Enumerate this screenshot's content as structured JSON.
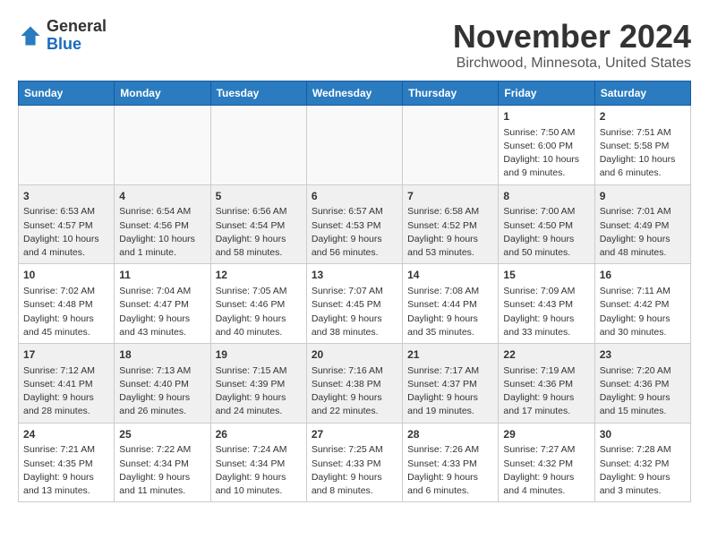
{
  "header": {
    "logo_general": "General",
    "logo_blue": "Blue",
    "month": "November 2024",
    "location": "Birchwood, Minnesota, United States"
  },
  "days_of_week": [
    "Sunday",
    "Monday",
    "Tuesday",
    "Wednesday",
    "Thursday",
    "Friday",
    "Saturday"
  ],
  "weeks": [
    [
      {
        "day": "",
        "text": ""
      },
      {
        "day": "",
        "text": ""
      },
      {
        "day": "",
        "text": ""
      },
      {
        "day": "",
        "text": ""
      },
      {
        "day": "",
        "text": ""
      },
      {
        "day": "1",
        "text": "Sunrise: 7:50 AM\nSunset: 6:00 PM\nDaylight: 10 hours and 9 minutes."
      },
      {
        "day": "2",
        "text": "Sunrise: 7:51 AM\nSunset: 5:58 PM\nDaylight: 10 hours and 6 minutes."
      }
    ],
    [
      {
        "day": "3",
        "text": "Sunrise: 6:53 AM\nSunset: 4:57 PM\nDaylight: 10 hours and 4 minutes."
      },
      {
        "day": "4",
        "text": "Sunrise: 6:54 AM\nSunset: 4:56 PM\nDaylight: 10 hours and 1 minute."
      },
      {
        "day": "5",
        "text": "Sunrise: 6:56 AM\nSunset: 4:54 PM\nDaylight: 9 hours and 58 minutes."
      },
      {
        "day": "6",
        "text": "Sunrise: 6:57 AM\nSunset: 4:53 PM\nDaylight: 9 hours and 56 minutes."
      },
      {
        "day": "7",
        "text": "Sunrise: 6:58 AM\nSunset: 4:52 PM\nDaylight: 9 hours and 53 minutes."
      },
      {
        "day": "8",
        "text": "Sunrise: 7:00 AM\nSunset: 4:50 PM\nDaylight: 9 hours and 50 minutes."
      },
      {
        "day": "9",
        "text": "Sunrise: 7:01 AM\nSunset: 4:49 PM\nDaylight: 9 hours and 48 minutes."
      }
    ],
    [
      {
        "day": "10",
        "text": "Sunrise: 7:02 AM\nSunset: 4:48 PM\nDaylight: 9 hours and 45 minutes."
      },
      {
        "day": "11",
        "text": "Sunrise: 7:04 AM\nSunset: 4:47 PM\nDaylight: 9 hours and 43 minutes."
      },
      {
        "day": "12",
        "text": "Sunrise: 7:05 AM\nSunset: 4:46 PM\nDaylight: 9 hours and 40 minutes."
      },
      {
        "day": "13",
        "text": "Sunrise: 7:07 AM\nSunset: 4:45 PM\nDaylight: 9 hours and 38 minutes."
      },
      {
        "day": "14",
        "text": "Sunrise: 7:08 AM\nSunset: 4:44 PM\nDaylight: 9 hours and 35 minutes."
      },
      {
        "day": "15",
        "text": "Sunrise: 7:09 AM\nSunset: 4:43 PM\nDaylight: 9 hours and 33 minutes."
      },
      {
        "day": "16",
        "text": "Sunrise: 7:11 AM\nSunset: 4:42 PM\nDaylight: 9 hours and 30 minutes."
      }
    ],
    [
      {
        "day": "17",
        "text": "Sunrise: 7:12 AM\nSunset: 4:41 PM\nDaylight: 9 hours and 28 minutes."
      },
      {
        "day": "18",
        "text": "Sunrise: 7:13 AM\nSunset: 4:40 PM\nDaylight: 9 hours and 26 minutes."
      },
      {
        "day": "19",
        "text": "Sunrise: 7:15 AM\nSunset: 4:39 PM\nDaylight: 9 hours and 24 minutes."
      },
      {
        "day": "20",
        "text": "Sunrise: 7:16 AM\nSunset: 4:38 PM\nDaylight: 9 hours and 22 minutes."
      },
      {
        "day": "21",
        "text": "Sunrise: 7:17 AM\nSunset: 4:37 PM\nDaylight: 9 hours and 19 minutes."
      },
      {
        "day": "22",
        "text": "Sunrise: 7:19 AM\nSunset: 4:36 PM\nDaylight: 9 hours and 17 minutes."
      },
      {
        "day": "23",
        "text": "Sunrise: 7:20 AM\nSunset: 4:36 PM\nDaylight: 9 hours and 15 minutes."
      }
    ],
    [
      {
        "day": "24",
        "text": "Sunrise: 7:21 AM\nSunset: 4:35 PM\nDaylight: 9 hours and 13 minutes."
      },
      {
        "day": "25",
        "text": "Sunrise: 7:22 AM\nSunset: 4:34 PM\nDaylight: 9 hours and 11 minutes."
      },
      {
        "day": "26",
        "text": "Sunrise: 7:24 AM\nSunset: 4:34 PM\nDaylight: 9 hours and 10 minutes."
      },
      {
        "day": "27",
        "text": "Sunrise: 7:25 AM\nSunset: 4:33 PM\nDaylight: 9 hours and 8 minutes."
      },
      {
        "day": "28",
        "text": "Sunrise: 7:26 AM\nSunset: 4:33 PM\nDaylight: 9 hours and 6 minutes."
      },
      {
        "day": "29",
        "text": "Sunrise: 7:27 AM\nSunset: 4:32 PM\nDaylight: 9 hours and 4 minutes."
      },
      {
        "day": "30",
        "text": "Sunrise: 7:28 AM\nSunset: 4:32 PM\nDaylight: 9 hours and 3 minutes."
      }
    ]
  ]
}
